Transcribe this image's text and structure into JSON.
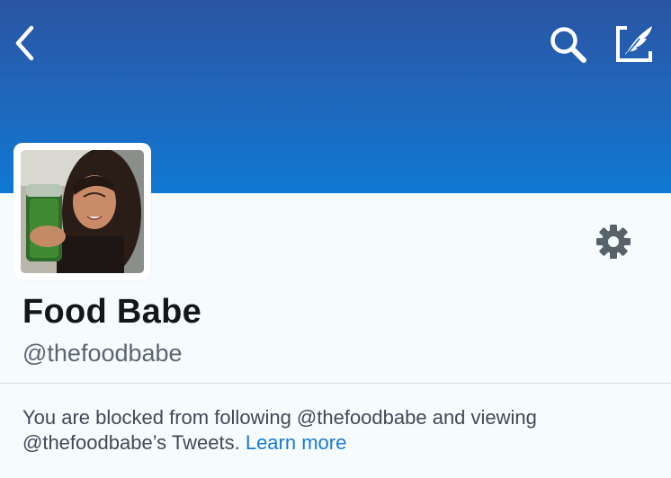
{
  "header": {
    "back_icon": "chevron-left-icon",
    "search_icon": "search-icon",
    "compose_icon": "compose-quill-icon",
    "gradient_top": "#2a55a3",
    "gradient_bottom": "#0f78d2"
  },
  "profile": {
    "display_name": "Food Babe",
    "handle": "@thefoodbabe",
    "settings_icon": "gear-icon"
  },
  "blocked_notice": {
    "text_line": "You are blocked from following @thefoodbabe and viewing @thefoodbabe’s Tweets.",
    "link_label": "Learn more",
    "link_color": "#1a7ad0"
  }
}
